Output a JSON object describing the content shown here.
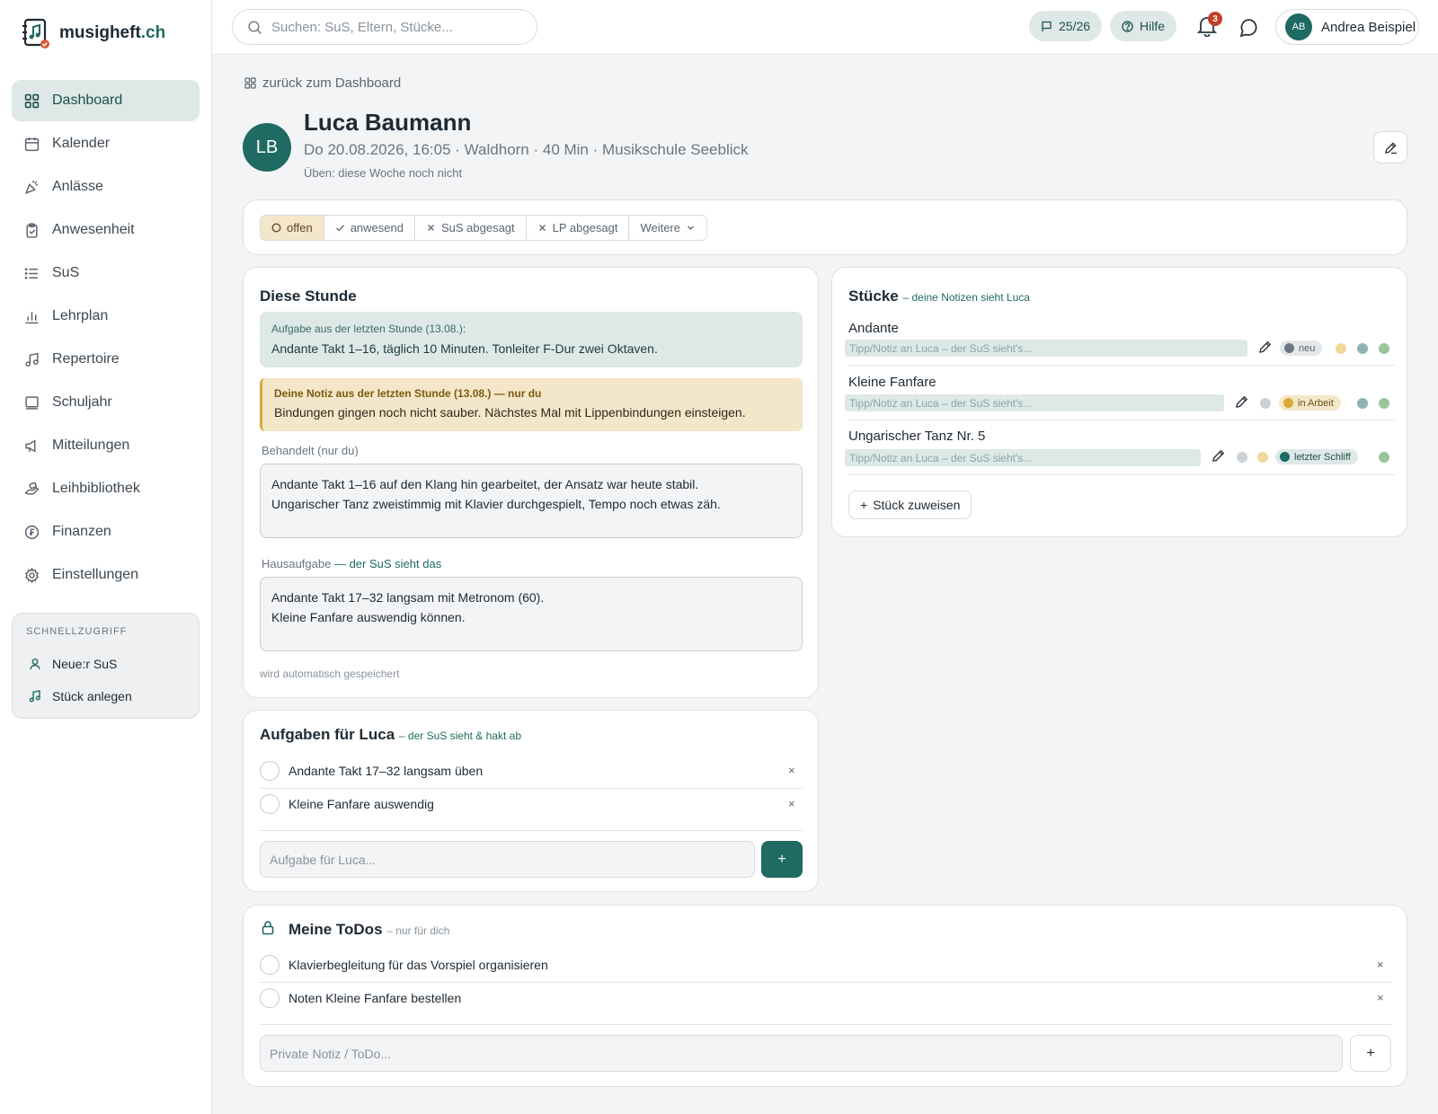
{
  "app": {
    "brand_name": "musigheft",
    "brand_tld": ".ch"
  },
  "sidebar": {
    "items": [
      {
        "label": "Dashboard",
        "icon": "grid-icon",
        "active": true
      },
      {
        "label": "Kalender",
        "icon": "calendar-icon"
      },
      {
        "label": "Anlässe",
        "icon": "party-icon"
      },
      {
        "label": "Anwesenheit",
        "icon": "clipboard-check-icon"
      },
      {
        "label": "SuS",
        "icon": "list-icon"
      },
      {
        "label": "Lehrplan",
        "icon": "bar-chart-icon"
      },
      {
        "label": "Repertoire",
        "icon": "music-note-icon"
      },
      {
        "label": "Schuljahr",
        "icon": "book-icon"
      },
      {
        "label": "Mitteilungen",
        "icon": "megaphone-icon"
      },
      {
        "label": "Leihbibliothek",
        "icon": "hand-icon"
      },
      {
        "label": "Finanzen",
        "icon": "franc-icon"
      },
      {
        "label": "Einstellungen",
        "icon": "gear-icon"
      }
    ],
    "quick": {
      "title": "SCHNELLZUGRIFF",
      "items": [
        {
          "label": "Neue:r SuS",
          "icon": "user-icon"
        },
        {
          "label": "Stück anlegen",
          "icon": "music-note-icon"
        }
      ]
    }
  },
  "topbar": {
    "search_placeholder": "Suchen: SuS, Eltern, Stücke...",
    "school_year": "25/26",
    "help_label": "Hilfe",
    "notification_count": "3",
    "user_initials": "AB",
    "user_name": "Andrea Beispiel"
  },
  "header": {
    "back_label": "zurück zum Dashboard",
    "initials": "LB",
    "name": "Luca Baumann",
    "meta": "Do 20.08.2026, 16:05 · Waldhorn · 40 Min · Musikschule Seeblick",
    "practice": "Üben: diese Woche noch nicht"
  },
  "status": {
    "options": [
      {
        "label": "offen",
        "icon": "circle-icon",
        "active": true
      },
      {
        "label": "anwesend",
        "icon": "check-icon"
      },
      {
        "label": "SuS abgesagt",
        "icon": "x-icon"
      },
      {
        "label": "LP abgesagt",
        "icon": "x-icon"
      },
      {
        "label": "Weitere",
        "icon": "chevron-down-icon"
      }
    ]
  },
  "lesson": {
    "title": "Diese Stunde",
    "last_task_label": "Aufgabe aus der letzten Stunde (13.08.):",
    "last_task_text": "Andante Takt 1–16, täglich 10 Minuten. Tonleiter F-Dur zwei Oktaven.",
    "last_note_label": "Deine Notiz aus der letzten Stunde (13.08.) — nur du",
    "last_note_text": "Bindungen gingen noch nicht sauber. Nächstes Mal mit Lippenbindungen einsteigen.",
    "covered_label": "Behandelt (nur du)",
    "covered_line1": "Andante Takt 1–16 auf den Klang hin gearbeitet, der Ansatz war heute stabil.",
    "covered_line2": "Ungarischer Tanz zweistimmig mit Klavier durchgespielt, Tempo noch etwas zäh.",
    "homework_label": "Hausaufgabe",
    "homework_hint": "— der SuS sieht das",
    "homework_line1": "Andante Takt 17–32 langsam mit Metronom (60).",
    "homework_line2": "Kleine Fanfare auswendig können.",
    "autosave": "wird automatisch gespeichert"
  },
  "tasks": {
    "title": "Aufgaben für Luca",
    "hint": "– der SuS sieht & hakt ab",
    "items": [
      "Andante Takt 17–32 langsam üben",
      "Kleine Fanfare auswendig"
    ],
    "placeholder": "Aufgabe für Luca...",
    "add_label": "+",
    "remove_label": "×"
  },
  "pieces": {
    "title": "Stücke",
    "hint": "– deine Notizen sieht Luca",
    "note_placeholder": "Tipp/Notiz an Luca – der SuS sieht's...",
    "items": [
      {
        "name": "Andante",
        "status": "neu"
      },
      {
        "name": "Kleine Fanfare",
        "status": "in Arbeit"
      },
      {
        "name": "Ungarischer Tanz Nr. 5",
        "status": "letzter Schliff"
      }
    ],
    "assign_label": "Stück zuweisen",
    "colors": {
      "neu": "#6b7680",
      "in_arbeit": "#d8a93a",
      "letzter_schliff": "#1f6a62",
      "sage": "#9bc49a",
      "teal": "#8fb3b6",
      "sand": "#f0d79a",
      "grey": "#cdd2d6"
    }
  },
  "todos": {
    "title": "Meine ToDos",
    "hint": "– nur für dich",
    "items": [
      "Klavierbegleitung für das Vorspiel organisieren",
      "Noten Kleine Fanfare bestellen"
    ],
    "placeholder": "Private Notiz / ToDo...",
    "add_label": "+",
    "remove_label": "×"
  }
}
